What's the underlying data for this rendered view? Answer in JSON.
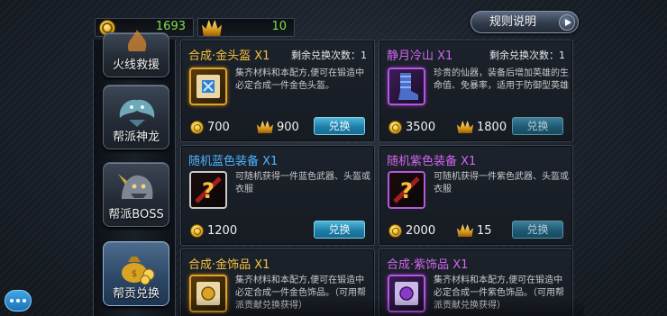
{
  "currency": {
    "coins": "1693",
    "contribution": "10"
  },
  "rules_button": "规则说明",
  "sidebar": {
    "items": [
      {
        "label": "火线救援"
      },
      {
        "label": "帮派神龙"
      },
      {
        "label": "帮派BOSS"
      },
      {
        "label": "帮贡兑换"
      }
    ]
  },
  "cards": [
    {
      "title": "合成·金头盔 X1",
      "remain": "剩余兑换次数：1",
      "desc": "集齐材料和本配方,便可在锻造中必定合成一件金色头盔。",
      "price_coin": "700",
      "price_crown": "900",
      "button": "兑换"
    },
    {
      "title": "静月冷山 X1",
      "remain": "剩余兑换次数：1",
      "desc": "珍贵的仙器，装备后增加英雄的生命值、免暴率，适用于防御型英雄",
      "price_coin": "3500",
      "price_crown": "1800",
      "button": "兑换"
    },
    {
      "title": "随机蓝色装备 X1",
      "desc": "可随机获得一件蓝色武器、头盔或衣服",
      "price_coin": "1200",
      "button": "兑换"
    },
    {
      "title": "随机紫色装备 X1",
      "desc": "可随机获得一件紫色武器、头盔或衣服",
      "price_coin": "2000",
      "price_crown": "15",
      "button": "兑换"
    },
    {
      "title": "合成·金饰品 X1",
      "desc": "集齐材料和本配方,便可在锻造中必定合成一件金色饰品。（可用帮派贡献兑换获得）"
    },
    {
      "title": "合成·紫饰品 X1",
      "desc": "集齐材料和本配方,便可在锻造中必定合成一件紫色饰品。（可用帮派贡献兑换获得）"
    }
  ]
}
